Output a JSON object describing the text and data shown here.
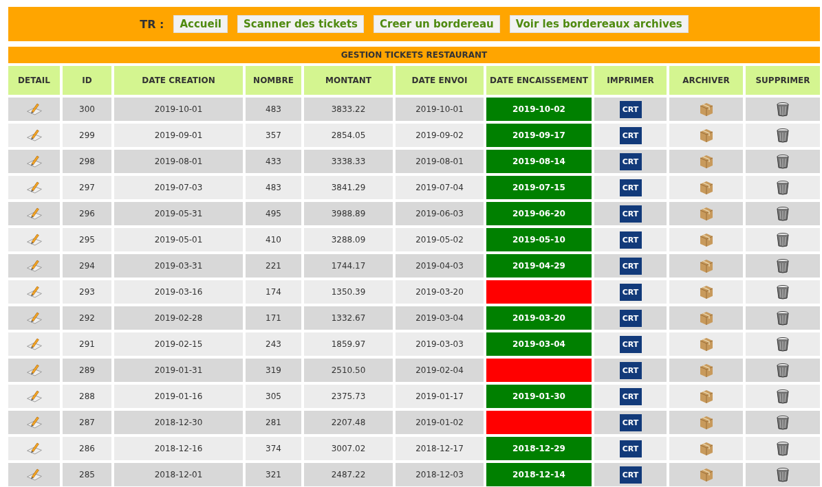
{
  "nav": {
    "label": "TR :",
    "links": [
      "Accueil",
      "Scanner des tickets",
      "Creer un bordereau",
      "Voir les bordereaux archives"
    ]
  },
  "table": {
    "title": "GESTION TICKETS RESTAURANT",
    "columns": [
      "DETAIL",
      "ID",
      "DATE CREATION",
      "NOMBRE",
      "MONTANT",
      "DATE ENVOI",
      "DATE ENCAISSEMENT",
      "IMPRIMER",
      "ARCHIVER",
      "SUPPRIMER"
    ],
    "rows": [
      {
        "id": "300",
        "date_creation": "2019-10-01",
        "nombre": "483",
        "montant": "3833.22",
        "date_envoi": "2019-10-01",
        "cashed": true,
        "date_encaissement": "2019-10-02",
        "print_label": "CRT"
      },
      {
        "id": "299",
        "date_creation": "2019-09-01",
        "nombre": "357",
        "montant": "2854.05",
        "date_envoi": "2019-09-02",
        "cashed": true,
        "date_encaissement": "2019-09-17",
        "print_label": "CRT"
      },
      {
        "id": "298",
        "date_creation": "2019-08-01",
        "nombre": "433",
        "montant": "3338.33",
        "date_envoi": "2019-08-01",
        "cashed": true,
        "date_encaissement": "2019-08-14",
        "print_label": "CRT"
      },
      {
        "id": "297",
        "date_creation": "2019-07-03",
        "nombre": "483",
        "montant": "3841.29",
        "date_envoi": "2019-07-04",
        "cashed": true,
        "date_encaissement": "2019-07-15",
        "print_label": "CRT"
      },
      {
        "id": "296",
        "date_creation": "2019-05-31",
        "nombre": "495",
        "montant": "3988.89",
        "date_envoi": "2019-06-03",
        "cashed": true,
        "date_encaissement": "2019-06-20",
        "print_label": "CRT"
      },
      {
        "id": "295",
        "date_creation": "2019-05-01",
        "nombre": "410",
        "montant": "3288.09",
        "date_envoi": "2019-05-02",
        "cashed": true,
        "date_encaissement": "2019-05-10",
        "print_label": "CRT"
      },
      {
        "id": "294",
        "date_creation": "2019-03-31",
        "nombre": "221",
        "montant": "1744.17",
        "date_envoi": "2019-04-03",
        "cashed": true,
        "date_encaissement": "2019-04-29",
        "print_label": "CRT"
      },
      {
        "id": "293",
        "date_creation": "2019-03-16",
        "nombre": "174",
        "montant": "1350.39",
        "date_envoi": "2019-03-20",
        "cashed": false,
        "print_label": "CRT"
      },
      {
        "id": "292",
        "date_creation": "2019-02-28",
        "nombre": "171",
        "montant": "1332.67",
        "date_envoi": "2019-03-04",
        "cashed": true,
        "date_encaissement": "2019-03-20",
        "print_label": "CRT"
      },
      {
        "id": "291",
        "date_creation": "2019-02-15",
        "nombre": "243",
        "montant": "1859.97",
        "date_envoi": "2019-03-03",
        "cashed": true,
        "date_encaissement": "2019-03-04",
        "print_label": "CRT"
      },
      {
        "id": "289",
        "date_creation": "2019-01-31",
        "nombre": "319",
        "montant": "2510.50",
        "date_envoi": "2019-02-04",
        "cashed": false,
        "print_label": "CRT"
      },
      {
        "id": "288",
        "date_creation": "2019-01-16",
        "nombre": "305",
        "montant": "2375.73",
        "date_envoi": "2019-01-17",
        "cashed": true,
        "date_encaissement": "2019-01-30",
        "print_label": "CRT"
      },
      {
        "id": "287",
        "date_creation": "2018-12-30",
        "nombre": "281",
        "montant": "2207.48",
        "date_envoi": "2019-01-02",
        "cashed": false,
        "print_label": "CRT"
      },
      {
        "id": "286",
        "date_creation": "2018-12-16",
        "nombre": "374",
        "montant": "3007.02",
        "date_envoi": "2018-12-17",
        "cashed": true,
        "date_encaissement": "2018-12-29",
        "print_label": "CRT"
      },
      {
        "id": "285",
        "date_creation": "2018-12-01",
        "nombre": "321",
        "montant": "2487.22",
        "date_envoi": "2018-12-03",
        "cashed": true,
        "date_encaissement": "2018-12-14",
        "print_label": "CRT"
      }
    ]
  }
}
